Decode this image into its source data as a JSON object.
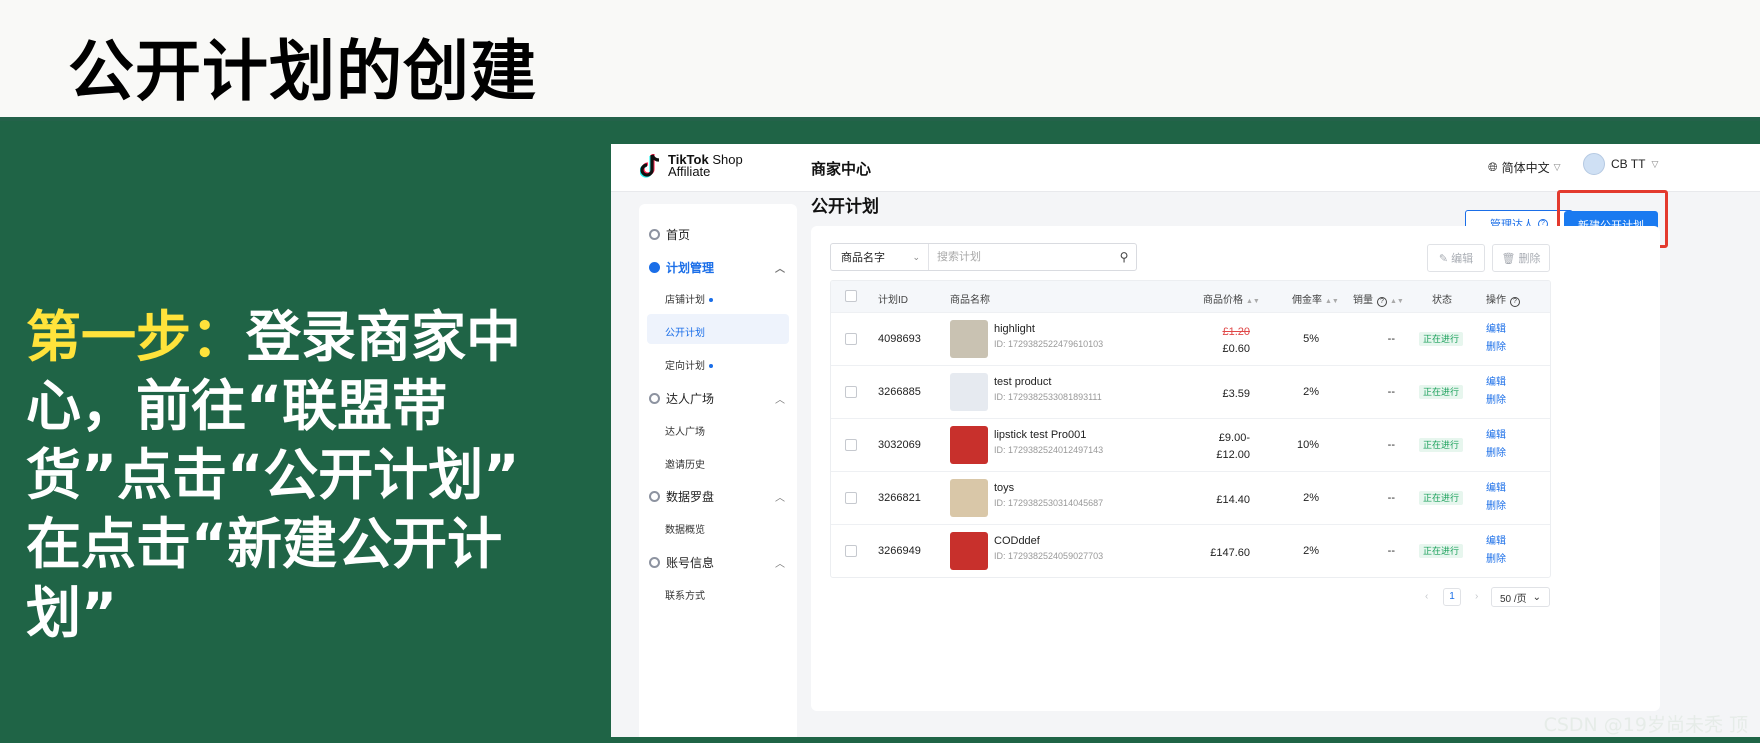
{
  "slide": {
    "title": "公开计划的创建",
    "step_highlight": "第一步：",
    "step_body": "登录商家中心，前往“联盟带货”点击“公开计划” 在点击“新建公开计划”",
    "watermark": "CSDN @19岁尚未秃 顶"
  },
  "app": {
    "logo_brand": "TikTok",
    "logo_shop": "Shop",
    "logo_sub": "Affiliate",
    "topbar_title": "商家中心",
    "language": "简体中文",
    "user_name": "CB TT"
  },
  "sidebar": {
    "home": "首页",
    "plan_mgmt": "计划管理",
    "shop_plan": "店铺计划",
    "public_plan": "公开计划",
    "targeted_plan": "定向计划",
    "creator_square": "达人广场",
    "creator_square_sub": "达人广场",
    "invite_history": "邀请历史",
    "data_compass": "数据罗盘",
    "data_overview": "数据概览",
    "account_info": "账号信息",
    "contact": "联系方式"
  },
  "page": {
    "title": "公开计划",
    "manage_creators": "管理达人",
    "new_public_plan": "新建公开计划",
    "search_filter": "商品名字",
    "search_placeholder": "搜索计划",
    "edit_button": "编辑",
    "delete_button": "删除"
  },
  "table": {
    "headers": {
      "plan_id": "计划ID",
      "product_name": "商品名称",
      "price": "商品价格",
      "commission": "佣金率",
      "sales": "销量",
      "status": "状态",
      "actions": "操作"
    },
    "rows": [
      {
        "id": "4098693",
        "name": "highlight",
        "pid": "ID: 1729382522479610103",
        "price_old": "£1.20",
        "price": "£0.60",
        "price2": "",
        "commission": "5%",
        "sales": "--",
        "status": "正在进行",
        "edit": "编辑",
        "delete": "删除",
        "thumb_color": "#c9c2b2"
      },
      {
        "id": "3266885",
        "name": "test product",
        "pid": "ID: 1729382533081893111",
        "price_old": "",
        "price": "£3.59",
        "price2": "",
        "commission": "2%",
        "sales": "--",
        "status": "正在进行",
        "edit": "编辑",
        "delete": "删除",
        "thumb_color": "#e6eaf0"
      },
      {
        "id": "3032069",
        "name": "lipstick test Pro001",
        "pid": "ID: 1729382524012497143",
        "price_old": "",
        "price": "£9.00-",
        "price2": "£12.00",
        "commission": "10%",
        "sales": "--",
        "status": "正在进行",
        "edit": "编辑",
        "delete": "删除",
        "thumb_color": "#c8302c"
      },
      {
        "id": "3266821",
        "name": "toys",
        "pid": "ID: 1729382530314045687",
        "price_old": "",
        "price": "£14.40",
        "price2": "",
        "commission": "2%",
        "sales": "--",
        "status": "正在进行",
        "edit": "编辑",
        "delete": "删除",
        "thumb_color": "#d9c7a8"
      },
      {
        "id": "3266949",
        "name": "CODddef",
        "pid": "ID: 1729382524059027703",
        "price_old": "",
        "price": "£147.60",
        "price2": "",
        "commission": "2%",
        "sales": "--",
        "status": "正在进行",
        "edit": "编辑",
        "delete": "删除",
        "thumb_color": "#c8302c"
      }
    ]
  },
  "pager": {
    "prev": "‹",
    "page": "1",
    "next": "›",
    "page_size": "50 /页"
  },
  "colors": {
    "slide_bg": "#1f6446",
    "highlight_yellow": "#ffe33b",
    "accent_blue": "#1a7af0",
    "callout_red": "#e33a2e",
    "status_green": "#1aa05a"
  }
}
